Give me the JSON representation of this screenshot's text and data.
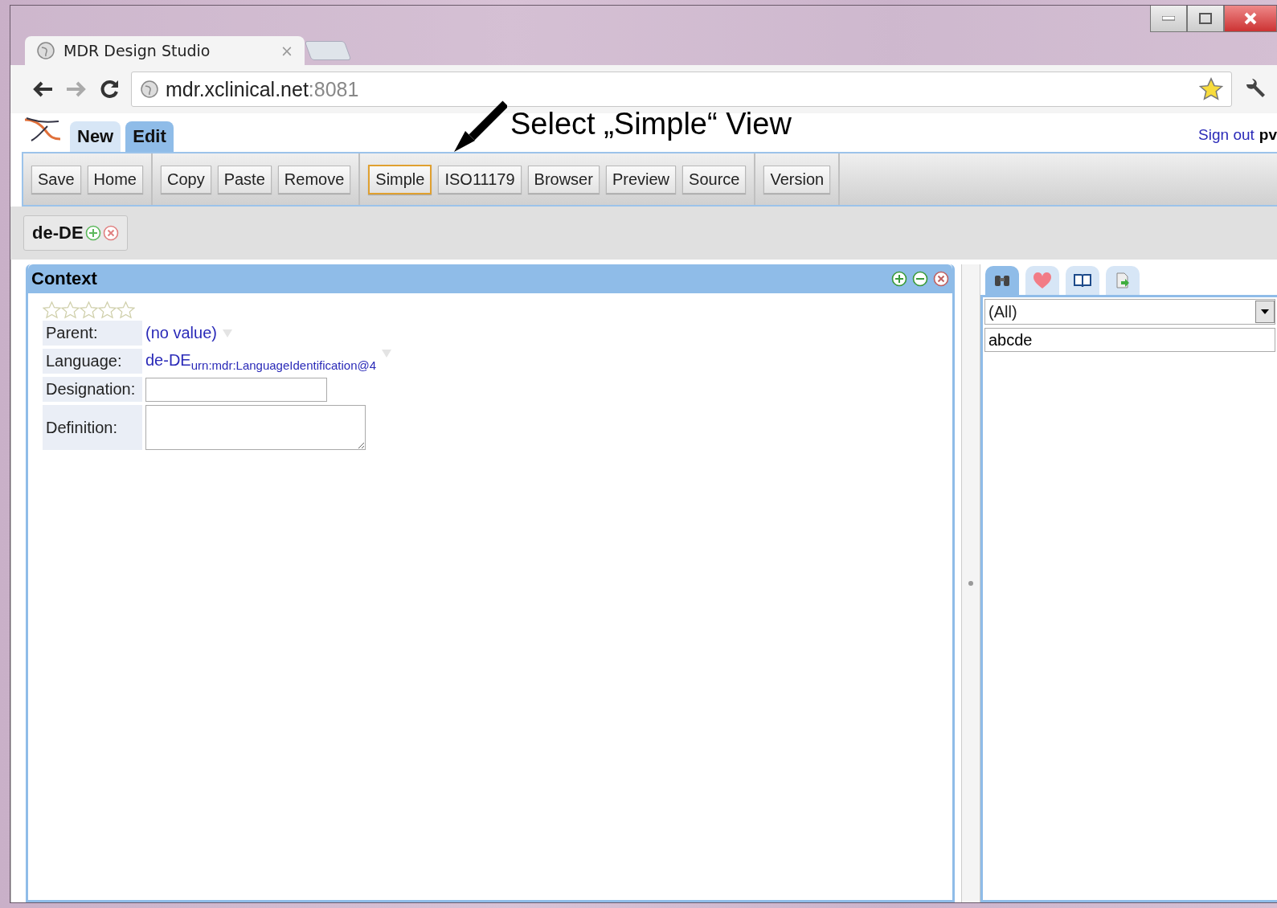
{
  "browser": {
    "tab_title": "MDR Design Studio",
    "tab_close": "×",
    "url_host": "mdr.xclinical.net",
    "url_port": ":8081"
  },
  "app_tabs": [
    {
      "label": "New",
      "selected": false
    },
    {
      "label": "Edit",
      "selected": true
    }
  ],
  "annotation": {
    "text": "Select „Simple“ View"
  },
  "user": {
    "sign_out": "Sign out",
    "name": "pv"
  },
  "toolbar_groups": [
    {
      "buttons": [
        {
          "label": "Save",
          "selected": false
        },
        {
          "label": "Home",
          "selected": false
        }
      ]
    },
    {
      "buttons": [
        {
          "label": "Copy",
          "selected": false
        },
        {
          "label": "Paste",
          "selected": false
        },
        {
          "label": "Remove",
          "selected": false
        }
      ]
    },
    {
      "buttons": [
        {
          "label": "Simple",
          "selected": true
        },
        {
          "label": "ISO11179",
          "selected": false
        },
        {
          "label": "Browser",
          "selected": false
        },
        {
          "label": "Preview",
          "selected": false
        },
        {
          "label": "Source",
          "selected": false
        }
      ]
    },
    {
      "buttons": [
        {
          "label": "Version",
          "selected": false
        }
      ]
    }
  ],
  "languages": [
    {
      "label": "de-DE"
    }
  ],
  "context_panel": {
    "title": "Context",
    "stars": 0,
    "fields": [
      {
        "kind": "link",
        "label": "Parent:",
        "value": "(no value)"
      },
      {
        "kind": "subscript",
        "label": "Language:",
        "value": "de-DE",
        "sub": "urn:mdr:LanguageIdentification@4"
      },
      {
        "kind": "input",
        "label": "Designation:"
      },
      {
        "kind": "textarea",
        "label": "Definition:"
      }
    ]
  },
  "side_panel": {
    "tabs": [
      {
        "kind": "binoculars",
        "selected": true
      },
      {
        "kind": "heart",
        "selected": false
      },
      {
        "kind": "book",
        "selected": false
      },
      {
        "kind": "export",
        "selected": false
      }
    ],
    "filter": {
      "value": "(All)"
    },
    "search": {
      "value": "abcde"
    }
  }
}
